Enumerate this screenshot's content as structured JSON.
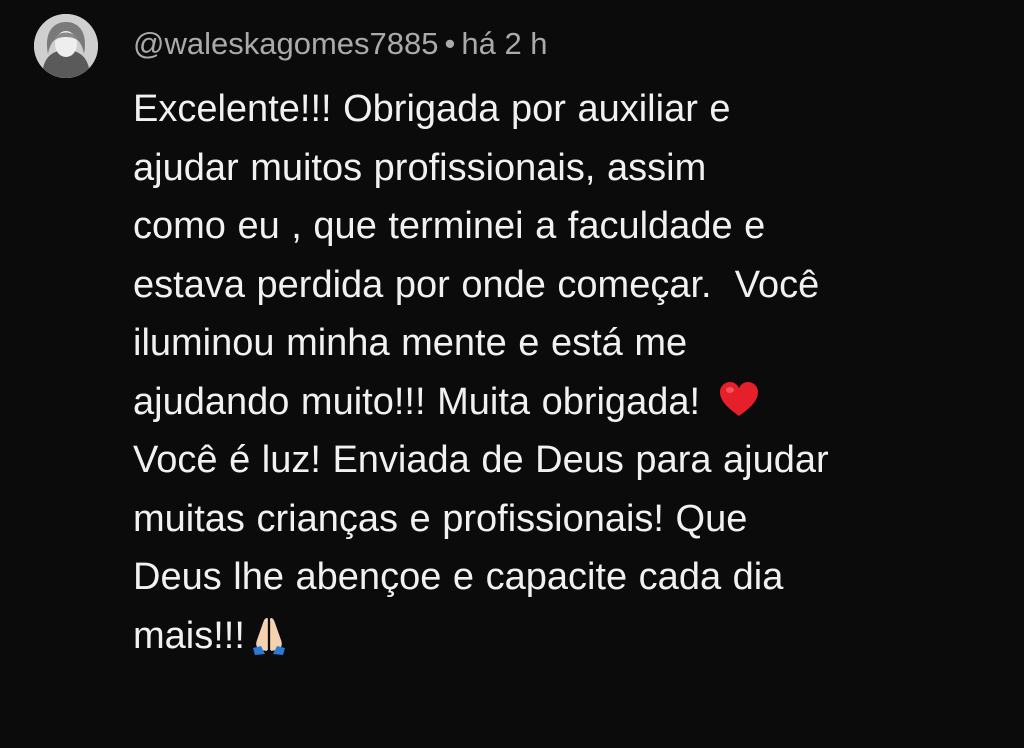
{
  "comment": {
    "author": "@waleskagomes7885",
    "separator": "•",
    "timestamp": "há 2 h",
    "lines": [
      "Excelente!!! Obrigada por auxiliar e",
      "ajudar muitos profissionais, assim",
      "como eu , que terminei a faculdade e",
      "estava perdida por onde começar.  Você",
      "iluminou minha mente e está me",
      "ajudando muito!!! Muita obrigada! ",
      "Você é luz! Enviada de Deus para ajudar",
      "muitas crianças e profissionais! Que",
      "Deus lhe abençoe e capacite cada dia",
      "mais!!!"
    ],
    "emojis": {
      "line_6_end": "red-heart-emoji",
      "line_10_end": "folded-hands-emoji"
    }
  },
  "colors": {
    "background": "#0b0b0b",
    "text_primary": "#f1f1f1",
    "text_secondary": "#aaaaaa",
    "heart_red": "#e5202b"
  }
}
